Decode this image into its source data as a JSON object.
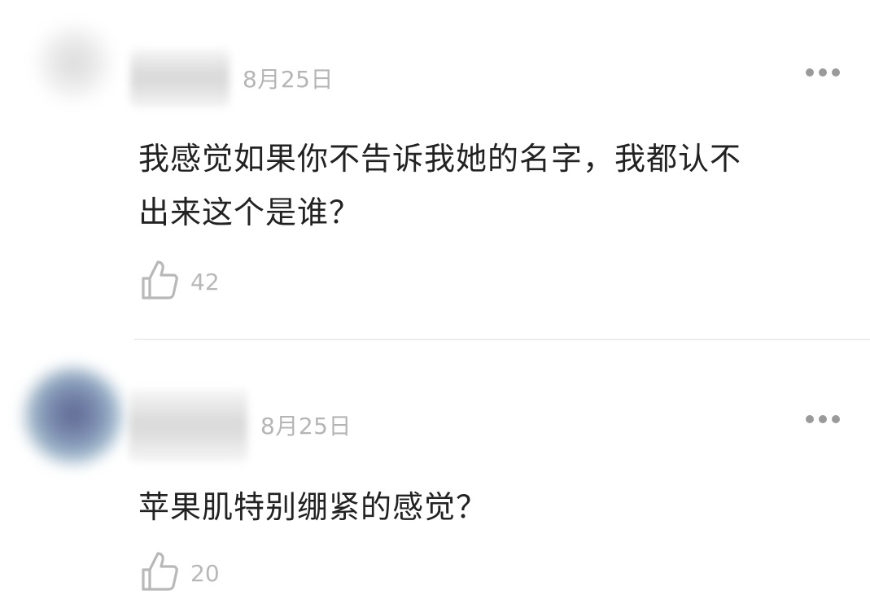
{
  "comments": [
    {
      "date": "8月25日",
      "text_lines": [
        "我感觉如果你不告诉我她的名字，我都认不",
        "出来这个是谁？"
      ],
      "likes": "42",
      "icons": {
        "more": "more-dots-icon",
        "like": "thumbs-up-icon"
      }
    },
    {
      "date": "8月25日",
      "text_lines": [
        "苹果肌特别绷紧的感觉？"
      ],
      "likes": "20",
      "icons": {
        "more": "more-dots-icon",
        "like": "thumbs-up-icon"
      }
    }
  ],
  "colors": {
    "text": "#222222",
    "meta": "#b5b5b5",
    "icon": "#b8b8b8",
    "divider": "#ececec"
  }
}
